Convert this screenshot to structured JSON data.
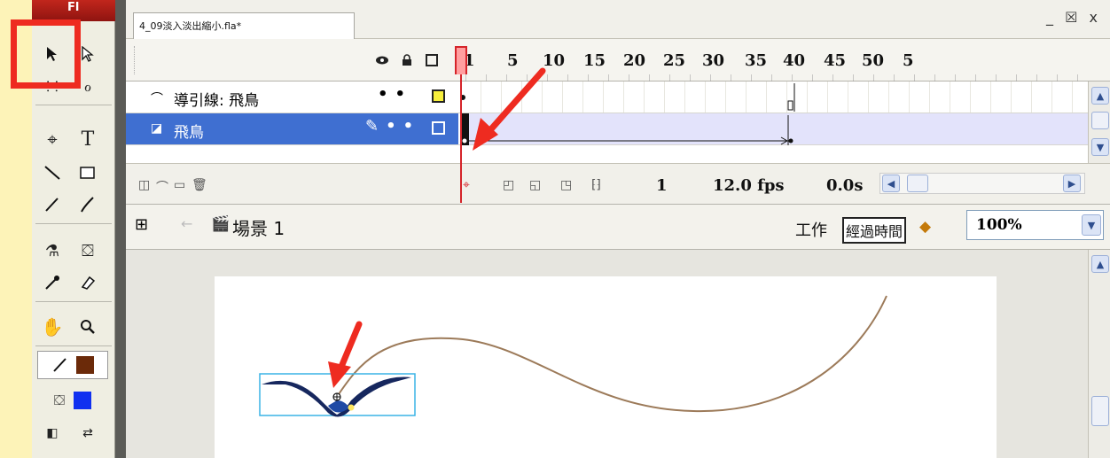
{
  "app": {
    "logo": "Fl"
  },
  "document": {
    "tab_title": "4_09淡入淡出縮小.fla*",
    "window_controls": "_ ☒ x"
  },
  "timeline": {
    "frame_numbers": [
      "1",
      "5",
      "10",
      "15",
      "20",
      "25",
      "30",
      "35",
      "40",
      "45",
      "50",
      "5"
    ],
    "layers": [
      {
        "name": "導引線: 飛鳥",
        "type": "motion-guide"
      },
      {
        "name": "飛鳥",
        "type": "normal",
        "selected": true
      }
    ],
    "status": {
      "current_frame": "1",
      "frame_rate": "12.0 fps",
      "elapsed": "0.0s"
    }
  },
  "editbar": {
    "scene": "場景 1",
    "workspace_label": "工作",
    "tooltip": "經過時間",
    "zoom": "100%"
  },
  "colors": {
    "highlight_red": "#ee2b20",
    "selected_layer": "#3f6fd1",
    "tween_span": "#e3e3fb",
    "guide_path": "#9c7a59",
    "playhead": "#d5242a"
  }
}
